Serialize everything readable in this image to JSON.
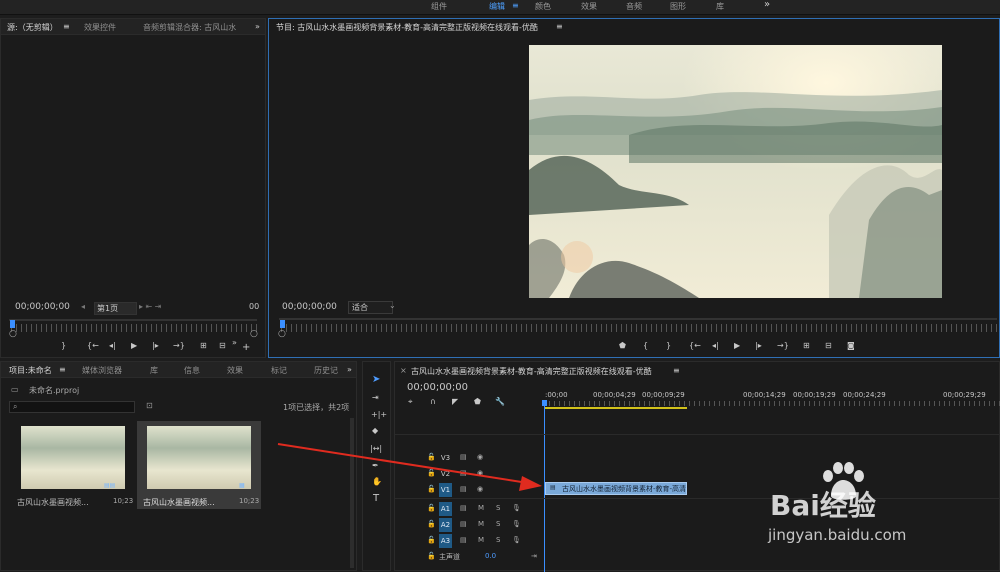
{
  "workspaces": [
    "组件",
    "编辑",
    "颜色",
    "效果",
    "音频",
    "图形",
    "库"
  ],
  "workspace_active": "编辑",
  "more_glyph": "»",
  "source_panel": {
    "tabs": [
      "源:（无剪辑）",
      "效果控件",
      "音频剪辑混合器: 古风山水"
    ],
    "timecode": "00;00;00;00",
    "page": "第1页",
    "timecode_right": "00"
  },
  "program_panel": {
    "title": "节目: 古风山水水墨画视频背景素材-教育-高清完整正版视频在线观看-优酷",
    "timecode": "00;00;00;00",
    "fit": "适合"
  },
  "project_panel": {
    "tabs": [
      "项目:未命名",
      "媒体浏览器",
      "库",
      "信息",
      "效果",
      "标记",
      "历史记"
    ],
    "file": "未命名.prproj",
    "selection": "1项已选择，共2项",
    "items": [
      {
        "name": "古风山水墨画视频...",
        "duration": "10;23"
      },
      {
        "name": "古风山水墨画视频...",
        "duration": "10;23"
      }
    ]
  },
  "timeline": {
    "title": "古风山水水墨画视频背景素材-教育-高清完整正版视频在线观看-优酷",
    "timecode": "00;00;00;00",
    "ruler": [
      ":00;00",
      "00;00;04;29",
      "00;00;09;29",
      "00;00;14;29",
      "00;00;19;29",
      "00;00;24;29",
      "00;00;29;29"
    ],
    "video_tracks": [
      "V3",
      "V2",
      "V1"
    ],
    "audio_tracks": [
      "A1",
      "A2",
      "A3"
    ],
    "master": "主声道",
    "master_value": "0.0",
    "clip_label": "古风山水水墨画视频背景素材-教育-高清",
    "m": "M",
    "s": "S"
  },
  "watermark": {
    "brand": "Bai经验",
    "url": "jingyan.baidu.com"
  },
  "colors": {
    "accent": "#4e9cff",
    "clip": "#7aa9d9",
    "playhead": "#3b8fff",
    "arrow": "#e02b1f"
  }
}
